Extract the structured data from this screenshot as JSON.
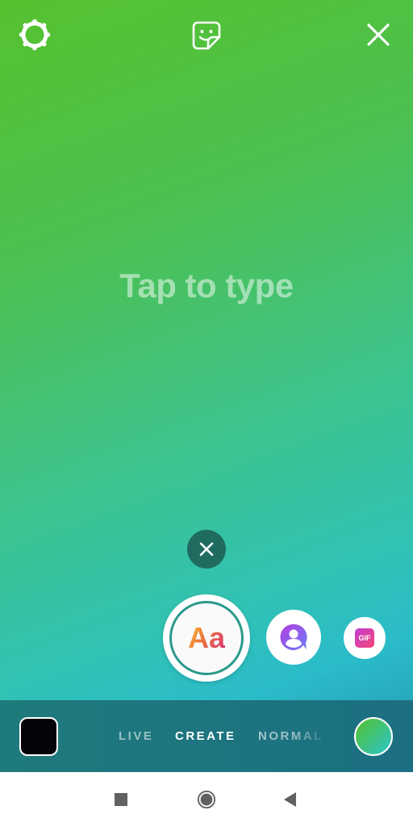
{
  "top_bar": {
    "settings_icon": "gear-icon",
    "sticker_icon": "sticker-icon",
    "close_icon": "close-icon"
  },
  "canvas": {
    "placeholder": "Tap to type",
    "gradient_colors": [
      "#55c22e",
      "#3ec38b",
      "#2bbcc9",
      "#2393b0"
    ]
  },
  "tools": {
    "dismiss_icon": "close-icon",
    "text_tool_label": "Aa",
    "mention_icon": "mention-icon",
    "gif_label": "GIF"
  },
  "bottom_bar": {
    "gallery_icon": "gallery-thumbnail",
    "modes": [
      {
        "label": "LIVE",
        "selected": false
      },
      {
        "label": "CREATE",
        "selected": true
      },
      {
        "label": "NORMAL",
        "selected": false
      }
    ],
    "color_picker_icon": "background-color-picker"
  },
  "navbar": {
    "recents_icon": "square-icon",
    "home_icon": "circle-icon",
    "back_icon": "triangle-back-icon"
  }
}
